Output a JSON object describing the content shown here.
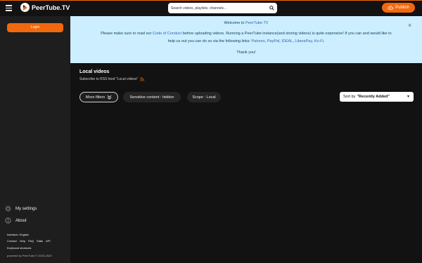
{
  "header": {
    "brand": "PeerTube.TV",
    "search_placeholder": "Search videos, playlists, channels…",
    "publish_label": "Publish"
  },
  "sidebar": {
    "login_label": "Login",
    "settings_label": "My settings",
    "about_label": "About",
    "interface_label": "Interface: English",
    "footer_links": [
      "Contact",
      "Help",
      "FAQ",
      "Stats",
      "API"
    ],
    "shortcuts_label": "Keyboard shortcuts",
    "powered_by": "powered by PeerTube © 2015-2023"
  },
  "banner": {
    "welcome_prefix": "Welcome to ",
    "welcome_link": "PeerTube.TV",
    "line1_prefix": "Please make sure to read our ",
    "line1_link": "Code of Conduct",
    "line1_suffix": " before uploading videos. Running a PeerTube instance(and storing videos) is quite expensive! If you can and would like to",
    "line2_prefix": "help us out you can do so via the following links: ",
    "links": [
      "Patreon",
      "PayPal",
      "IDEAL",
      "LiberaPay",
      "Ko-Fi"
    ],
    "link_separator": ", ",
    "line2_suffix": ".",
    "thanks": "Thank you!"
  },
  "main": {
    "title": "Local videos",
    "rss_text": "Subscribe to RSS feed \"Local videos\"",
    "more_filters_label": "More filters",
    "sensitive_label": "Sensitive content : hidden",
    "scope_label": "Scope : Local",
    "sort_prefix": "Sort by",
    "sort_value": "\"Recently Added\""
  },
  "colors": {
    "accent": "#f1680d",
    "banner_bg": "#cdeefe",
    "sidebar_bg": "#1e1e1e",
    "page_bg": "#121212"
  }
}
